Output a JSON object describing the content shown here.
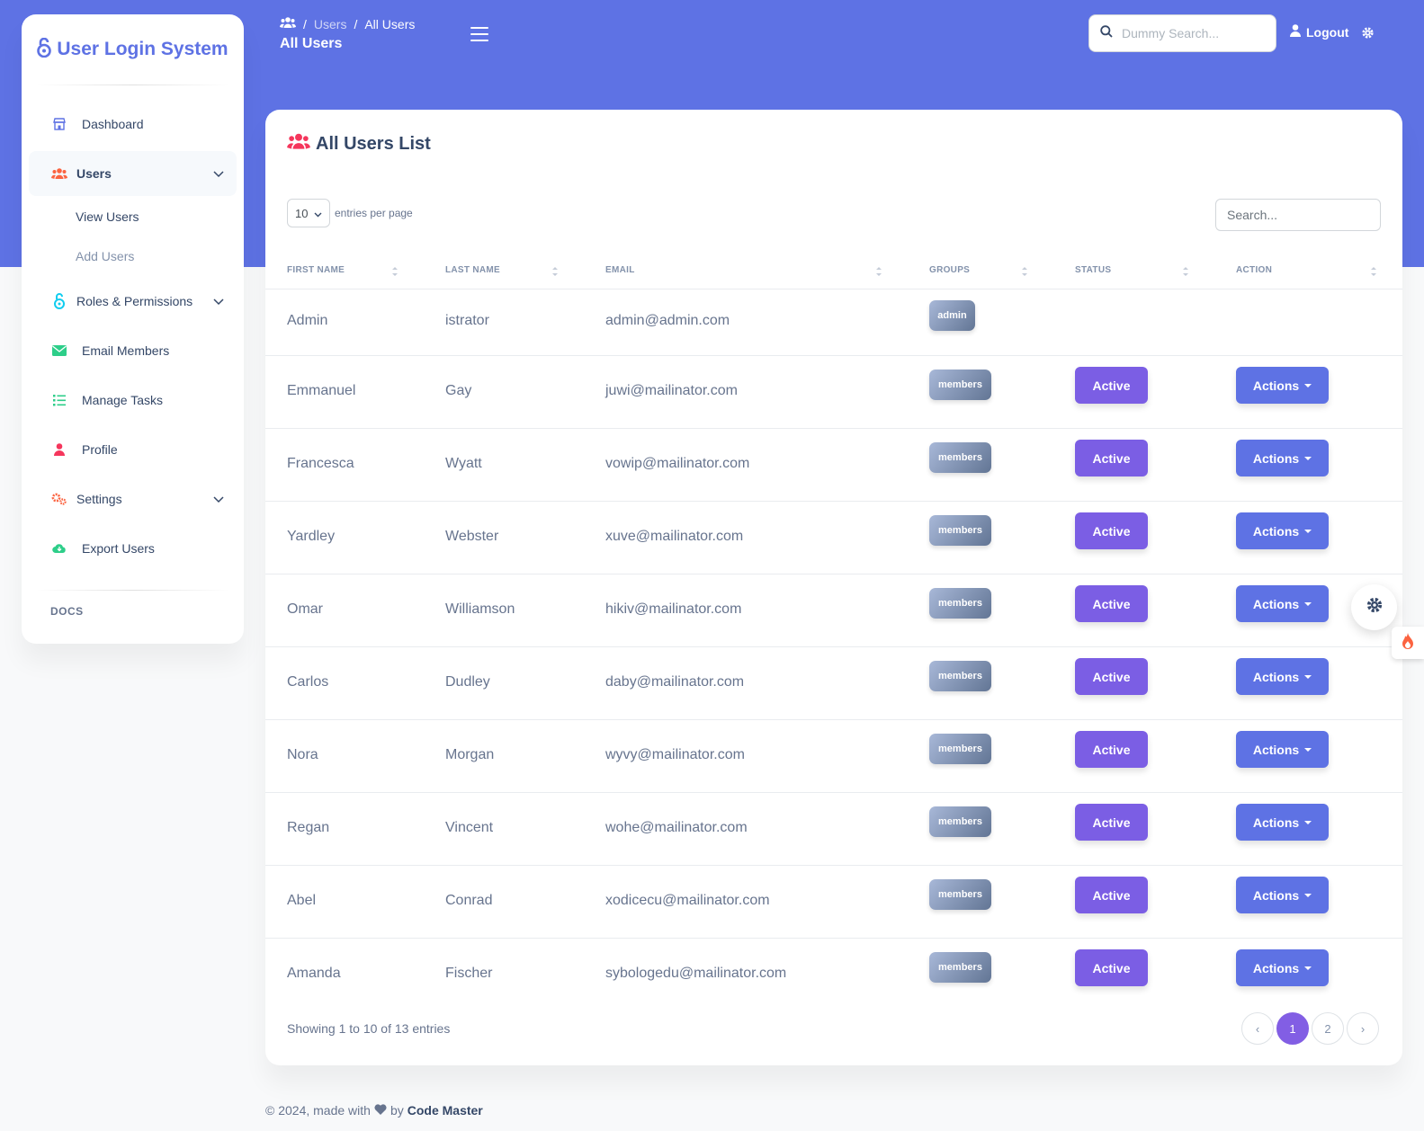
{
  "app": {
    "brand": "User Login System"
  },
  "sidebar": {
    "items": [
      {
        "label": "Dashboard"
      },
      {
        "label": "Users"
      },
      {
        "label": "Roles & Permissions"
      },
      {
        "label": "Email Members"
      },
      {
        "label": "Manage Tasks"
      },
      {
        "label": "Profile"
      },
      {
        "label": "Settings"
      },
      {
        "label": "Export Users"
      }
    ],
    "users_sub": {
      "view": "View Users",
      "add": "Add Users"
    },
    "docs_label": "DOCS"
  },
  "topbar": {
    "breadcrumb_sep": "/",
    "breadcrumb_parent": "Users",
    "breadcrumb_current": "All Users",
    "page_title": "All Users",
    "search_placeholder": "Dummy Search...",
    "logout_label": "Logout"
  },
  "card": {
    "title": "All Users List",
    "entries_value": "10",
    "entries_label": "entries per page",
    "search_placeholder": "Search...",
    "columns": [
      "FIRST NAME",
      "LAST NAME",
      "EMAIL",
      "GROUPS",
      "STATUS",
      "ACTION"
    ],
    "rows": [
      {
        "first": "Admin",
        "last": "istrator",
        "email": "admin@admin.com",
        "group": "admin",
        "status": "",
        "action": ""
      },
      {
        "first": "Emmanuel",
        "last": "Gay",
        "email": "juwi@mailinator.com",
        "group": "members",
        "status": "Active",
        "action": "Actions"
      },
      {
        "first": "Francesca",
        "last": "Wyatt",
        "email": "vowip@mailinator.com",
        "group": "members",
        "status": "Active",
        "action": "Actions"
      },
      {
        "first": "Yardley",
        "last": "Webster",
        "email": "xuve@mailinator.com",
        "group": "members",
        "status": "Active",
        "action": "Actions"
      },
      {
        "first": "Omar",
        "last": "Williamson",
        "email": "hikiv@mailinator.com",
        "group": "members",
        "status": "Active",
        "action": "Actions"
      },
      {
        "first": "Carlos",
        "last": "Dudley",
        "email": "daby@mailinator.com",
        "group": "members",
        "status": "Active",
        "action": "Actions"
      },
      {
        "first": "Nora",
        "last": "Morgan",
        "email": "wyvy@mailinator.com",
        "group": "members",
        "status": "Active",
        "action": "Actions"
      },
      {
        "first": "Regan",
        "last": "Vincent",
        "email": "wohe@mailinator.com",
        "group": "members",
        "status": "Active",
        "action": "Actions"
      },
      {
        "first": "Abel",
        "last": "Conrad",
        "email": "xodicecu@mailinator.com",
        "group": "members",
        "status": "Active",
        "action": "Actions"
      },
      {
        "first": "Amanda",
        "last": "Fischer",
        "email": "sybologedu@mailinator.com",
        "group": "members",
        "status": "Active",
        "action": "Actions"
      }
    ],
    "showing": "Showing 1 to 10 of 13 entries",
    "pagination": {
      "prev": "‹",
      "pages": [
        "1",
        "2"
      ],
      "next": "›",
      "current": "1"
    }
  },
  "footer": {
    "prefix": "© 2024, made with",
    "by": "by",
    "author": "Code Master"
  },
  "colors": {
    "primary": "#5e72e4",
    "status": "#7b5ee4",
    "badge": "#8392ab"
  },
  "icons": [
    "users-icon",
    "menu-icon",
    "search-icon",
    "user-icon",
    "gear-icon",
    "lock-icon",
    "shop-icon",
    "envelope-icon",
    "list-icon",
    "fire-icon",
    "heart-icon"
  ]
}
